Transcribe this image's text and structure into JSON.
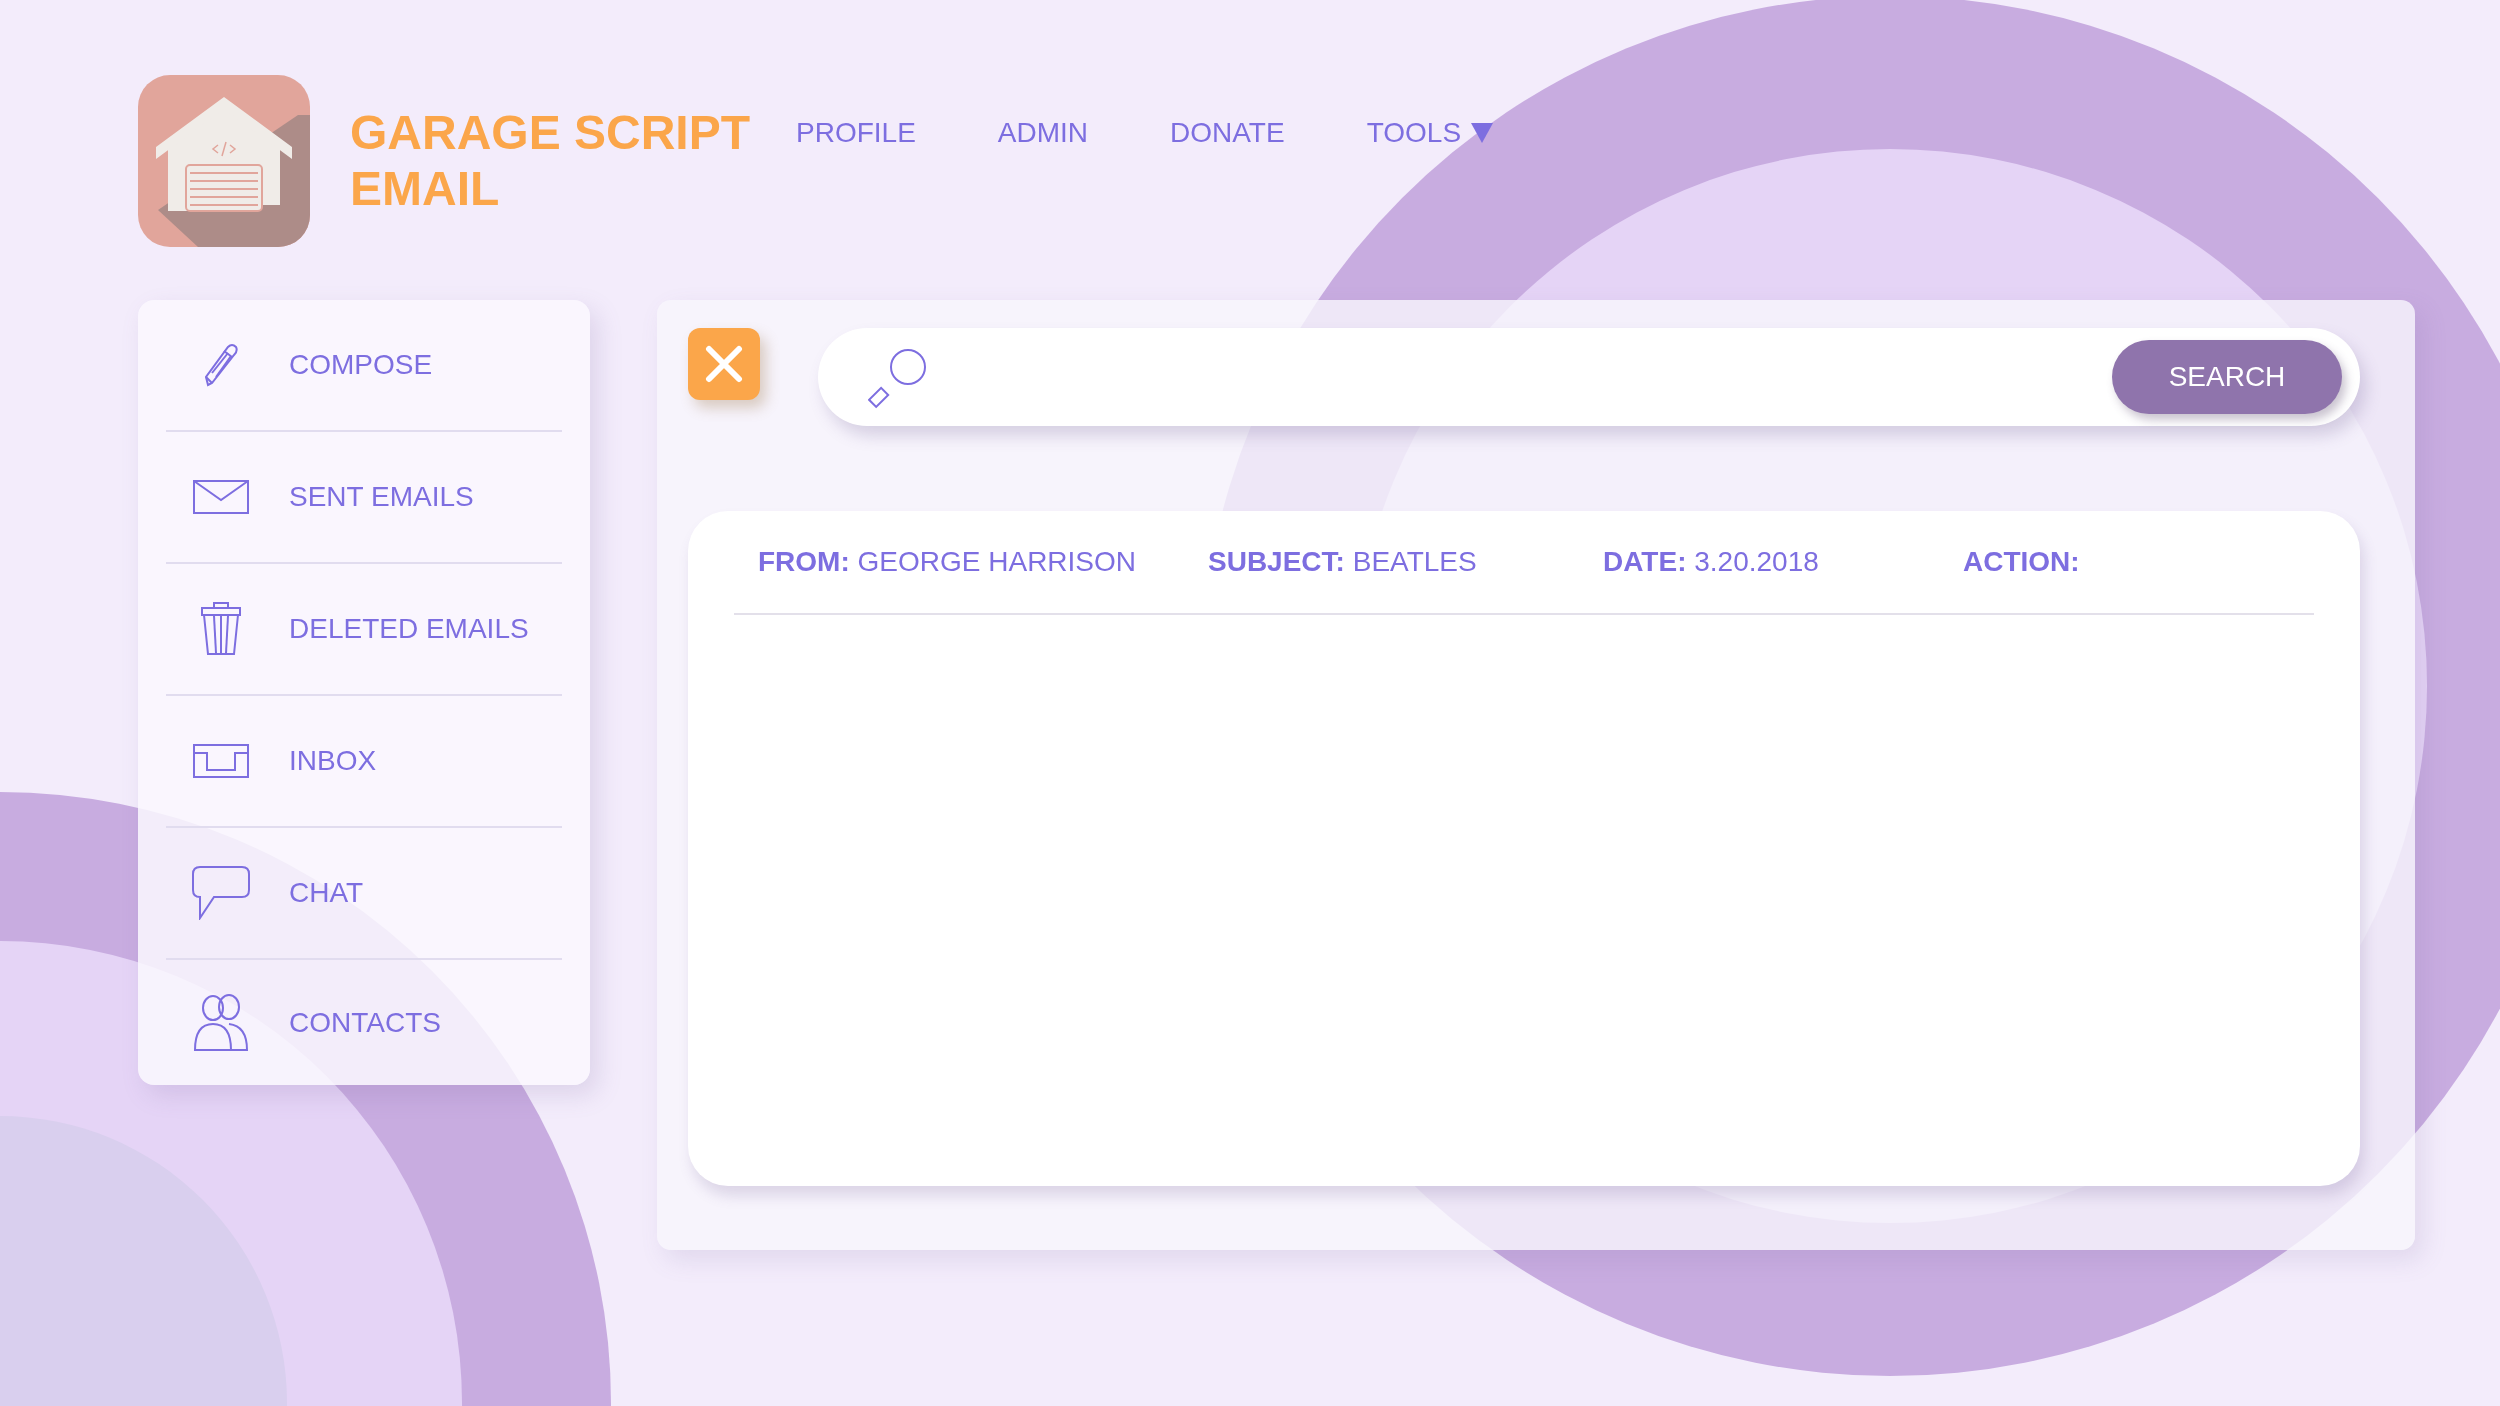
{
  "app": {
    "title": "GARAGE SCRIPT EMAIL"
  },
  "nav": [
    {
      "label": "PROFILE",
      "dropdown": false
    },
    {
      "label": "ADMIN",
      "dropdown": false
    },
    {
      "label": "DONATE",
      "dropdown": false
    },
    {
      "label": "TOOLS",
      "dropdown": true
    }
  ],
  "sidebar": {
    "items": [
      {
        "label": "COMPOSE"
      },
      {
        "label": "SENT EMAILS"
      },
      {
        "label": "DELETED EMAILS"
      },
      {
        "label": "INBOX"
      },
      {
        "label": "CHAT"
      },
      {
        "label": "CONTACTS"
      }
    ]
  },
  "search": {
    "button": "SEARCH"
  },
  "table": {
    "columns": [
      {
        "label": "**FROM:** GEORGE HARRISON"
      },
      {
        "label": "**SUBJECT:** BEATLES"
      },
      {
        "label": "**DATE:** 3.20.2018"
      },
      {
        "label": "**ACTION:**"
      }
    ]
  }
}
